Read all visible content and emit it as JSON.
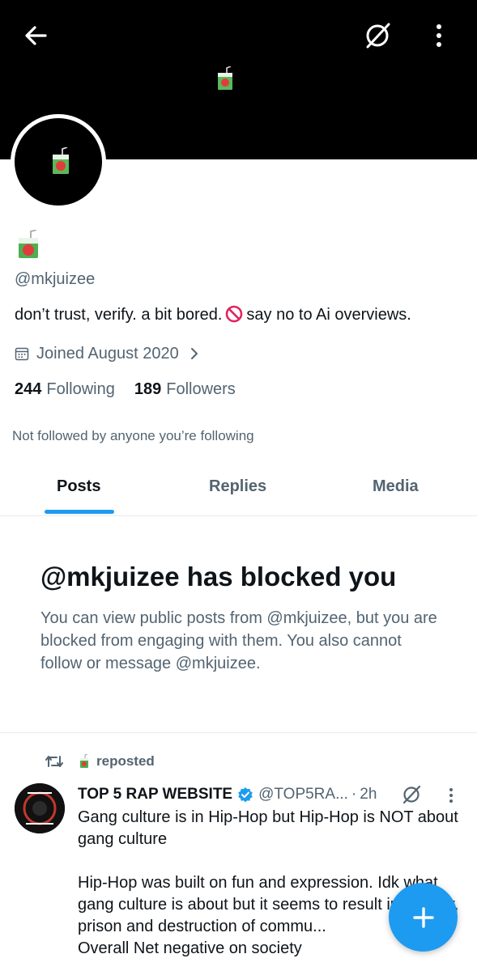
{
  "profile": {
    "handle": "@mkjuizee",
    "bio_before": "don’t trust, verify. a bit bored.",
    "bio_after": "say no to Ai overviews.",
    "joined": "Joined August 2020",
    "following_count": "244",
    "following_label": "Following",
    "followers_count": "189",
    "followers_label": "Followers",
    "not_followed": "Not followed by anyone you’re following"
  },
  "tabs": [
    {
      "label": "Posts",
      "active": true
    },
    {
      "label": "Replies",
      "active": false
    },
    {
      "label": "Media",
      "active": false
    }
  ],
  "blocked": {
    "title": "@mkjuizee has blocked you",
    "body": "You can view public posts from @mkjuizee, but you are blocked from engaging with them. You also cannot follow or message @mkjuizee."
  },
  "post": {
    "repost_label": "reposted",
    "author_name": "TOP 5 RAP WEBSITE",
    "author_handle": "@TOP5RA...",
    "separator": "·",
    "time": "2h",
    "text": "Gang culture is in Hip-Hop but Hip-Hop is NOT about gang culture\n\nHip-Hop was built on fun and expression. Idk what gang culture is about but it seems to result in murder, prison and destruction of commu...\nOverall Net negative on society"
  },
  "colors": {
    "accent": "#1d9bf0",
    "text_primary": "#0f1419",
    "text_secondary": "#536471",
    "banner": "#000000"
  },
  "icons": {
    "back": "arrow-left-icon",
    "grok": "grok-icon",
    "more": "more-vertical-icon",
    "calendar": "calendar-icon",
    "chevron": "chevron-right-icon",
    "repost": "repost-icon",
    "verified": "verified-badge-icon",
    "compose": "plus-icon",
    "prohibited": "prohibited-emoji-icon",
    "juice": "juice-box-emoji-icon"
  }
}
